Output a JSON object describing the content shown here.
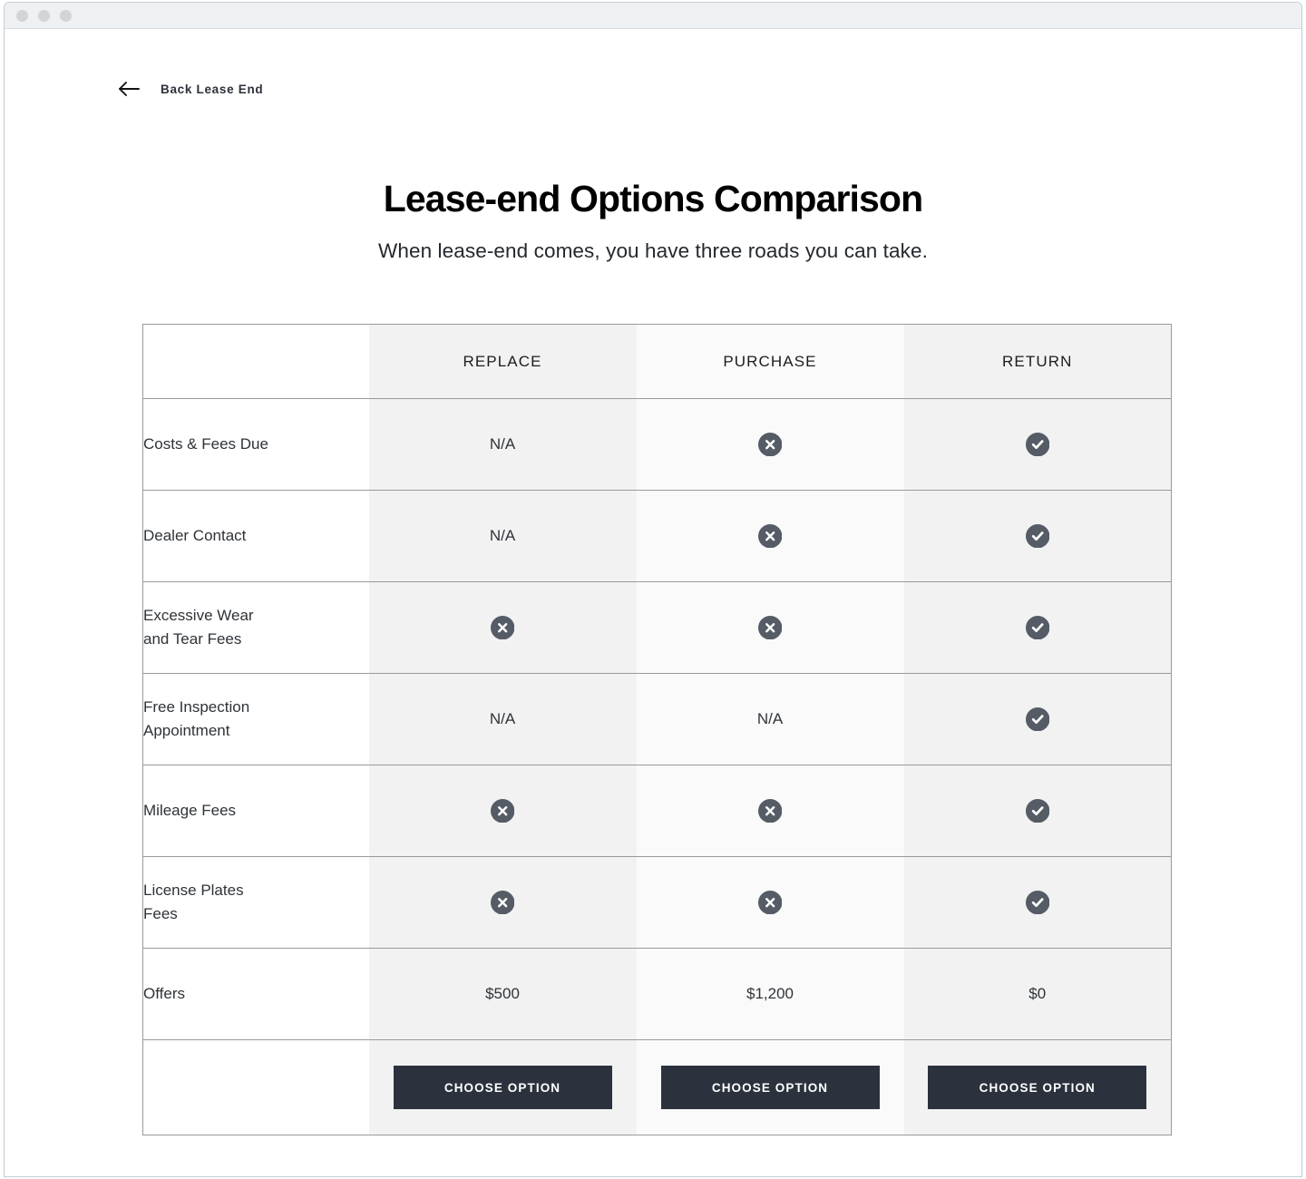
{
  "window": {
    "traffic_lights": [
      "close",
      "minimize",
      "maximize"
    ]
  },
  "nav": {
    "back_icon": "arrow-left-icon",
    "back_label": "Back Lease End"
  },
  "header": {
    "title": "Lease-end Options Comparison",
    "subtitle": "When lease-end comes, you have three roads you can take."
  },
  "comparison_table": {
    "row_header_label": "",
    "columns": [
      {
        "key": "replace",
        "label": "REPLACE",
        "tint": "#f2f2f2"
      },
      {
        "key": "purchase",
        "label": "PURCHASE",
        "tint": "#fafafa"
      },
      {
        "key": "return",
        "label": "RETURN",
        "tint": "#f2f2f2"
      }
    ],
    "rows": [
      {
        "label": "Costs & Fees Due",
        "cells": [
          {
            "type": "text",
            "value": "N/A"
          },
          {
            "type": "icon",
            "icon": "circle-x-icon"
          },
          {
            "type": "icon",
            "icon": "circle-check-icon"
          }
        ]
      },
      {
        "label": "Dealer Contact",
        "cells": [
          {
            "type": "text",
            "value": "N/A"
          },
          {
            "type": "icon",
            "icon": "circle-x-icon"
          },
          {
            "type": "icon",
            "icon": "circle-check-icon"
          }
        ]
      },
      {
        "label": "Excessive Wear and Tear Fees",
        "label_lines": [
          "Excessive Wear",
          "and Tear Fees"
        ],
        "cells": [
          {
            "type": "icon",
            "icon": "circle-x-icon"
          },
          {
            "type": "icon",
            "icon": "circle-x-icon"
          },
          {
            "type": "icon",
            "icon": "circle-check-icon"
          }
        ]
      },
      {
        "label": "Free Inspection Appointment",
        "label_lines": [
          "Free Inspection",
          "Appointment"
        ],
        "cells": [
          {
            "type": "text",
            "value": "N/A"
          },
          {
            "type": "text",
            "value": "N/A"
          },
          {
            "type": "icon",
            "icon": "circle-check-icon"
          }
        ]
      },
      {
        "label": "Mileage Fees",
        "cells": [
          {
            "type": "icon",
            "icon": "circle-x-icon"
          },
          {
            "type": "icon",
            "icon": "circle-x-icon"
          },
          {
            "type": "icon",
            "icon": "circle-check-icon"
          }
        ]
      },
      {
        "label": "License Plates Fees",
        "label_lines": [
          "License Plates",
          "Fees"
        ],
        "cells": [
          {
            "type": "icon",
            "icon": "circle-x-icon"
          },
          {
            "type": "icon",
            "icon": "circle-x-icon"
          },
          {
            "type": "icon",
            "icon": "circle-check-icon"
          }
        ]
      },
      {
        "label": "Offers",
        "cells": [
          {
            "type": "text",
            "value": "$500"
          },
          {
            "type": "text",
            "value": "$1,200"
          },
          {
            "type": "text",
            "value": "$0"
          }
        ]
      }
    ],
    "cta_row": {
      "buttons": [
        {
          "label": "CHOOSE OPTION",
          "column": "replace"
        },
        {
          "label": "CHOOSE OPTION",
          "column": "purchase"
        },
        {
          "label": "CHOOSE OPTION",
          "column": "return"
        }
      ]
    }
  },
  "colors": {
    "icon_fill": "#555c66",
    "icon_glyph": "#ffffff",
    "button_bg": "#2b323e",
    "button_text": "#ffffff",
    "table_border": "#9a9a9a",
    "title_text": "#000000",
    "titlebar_bg": "#eef1f4"
  }
}
